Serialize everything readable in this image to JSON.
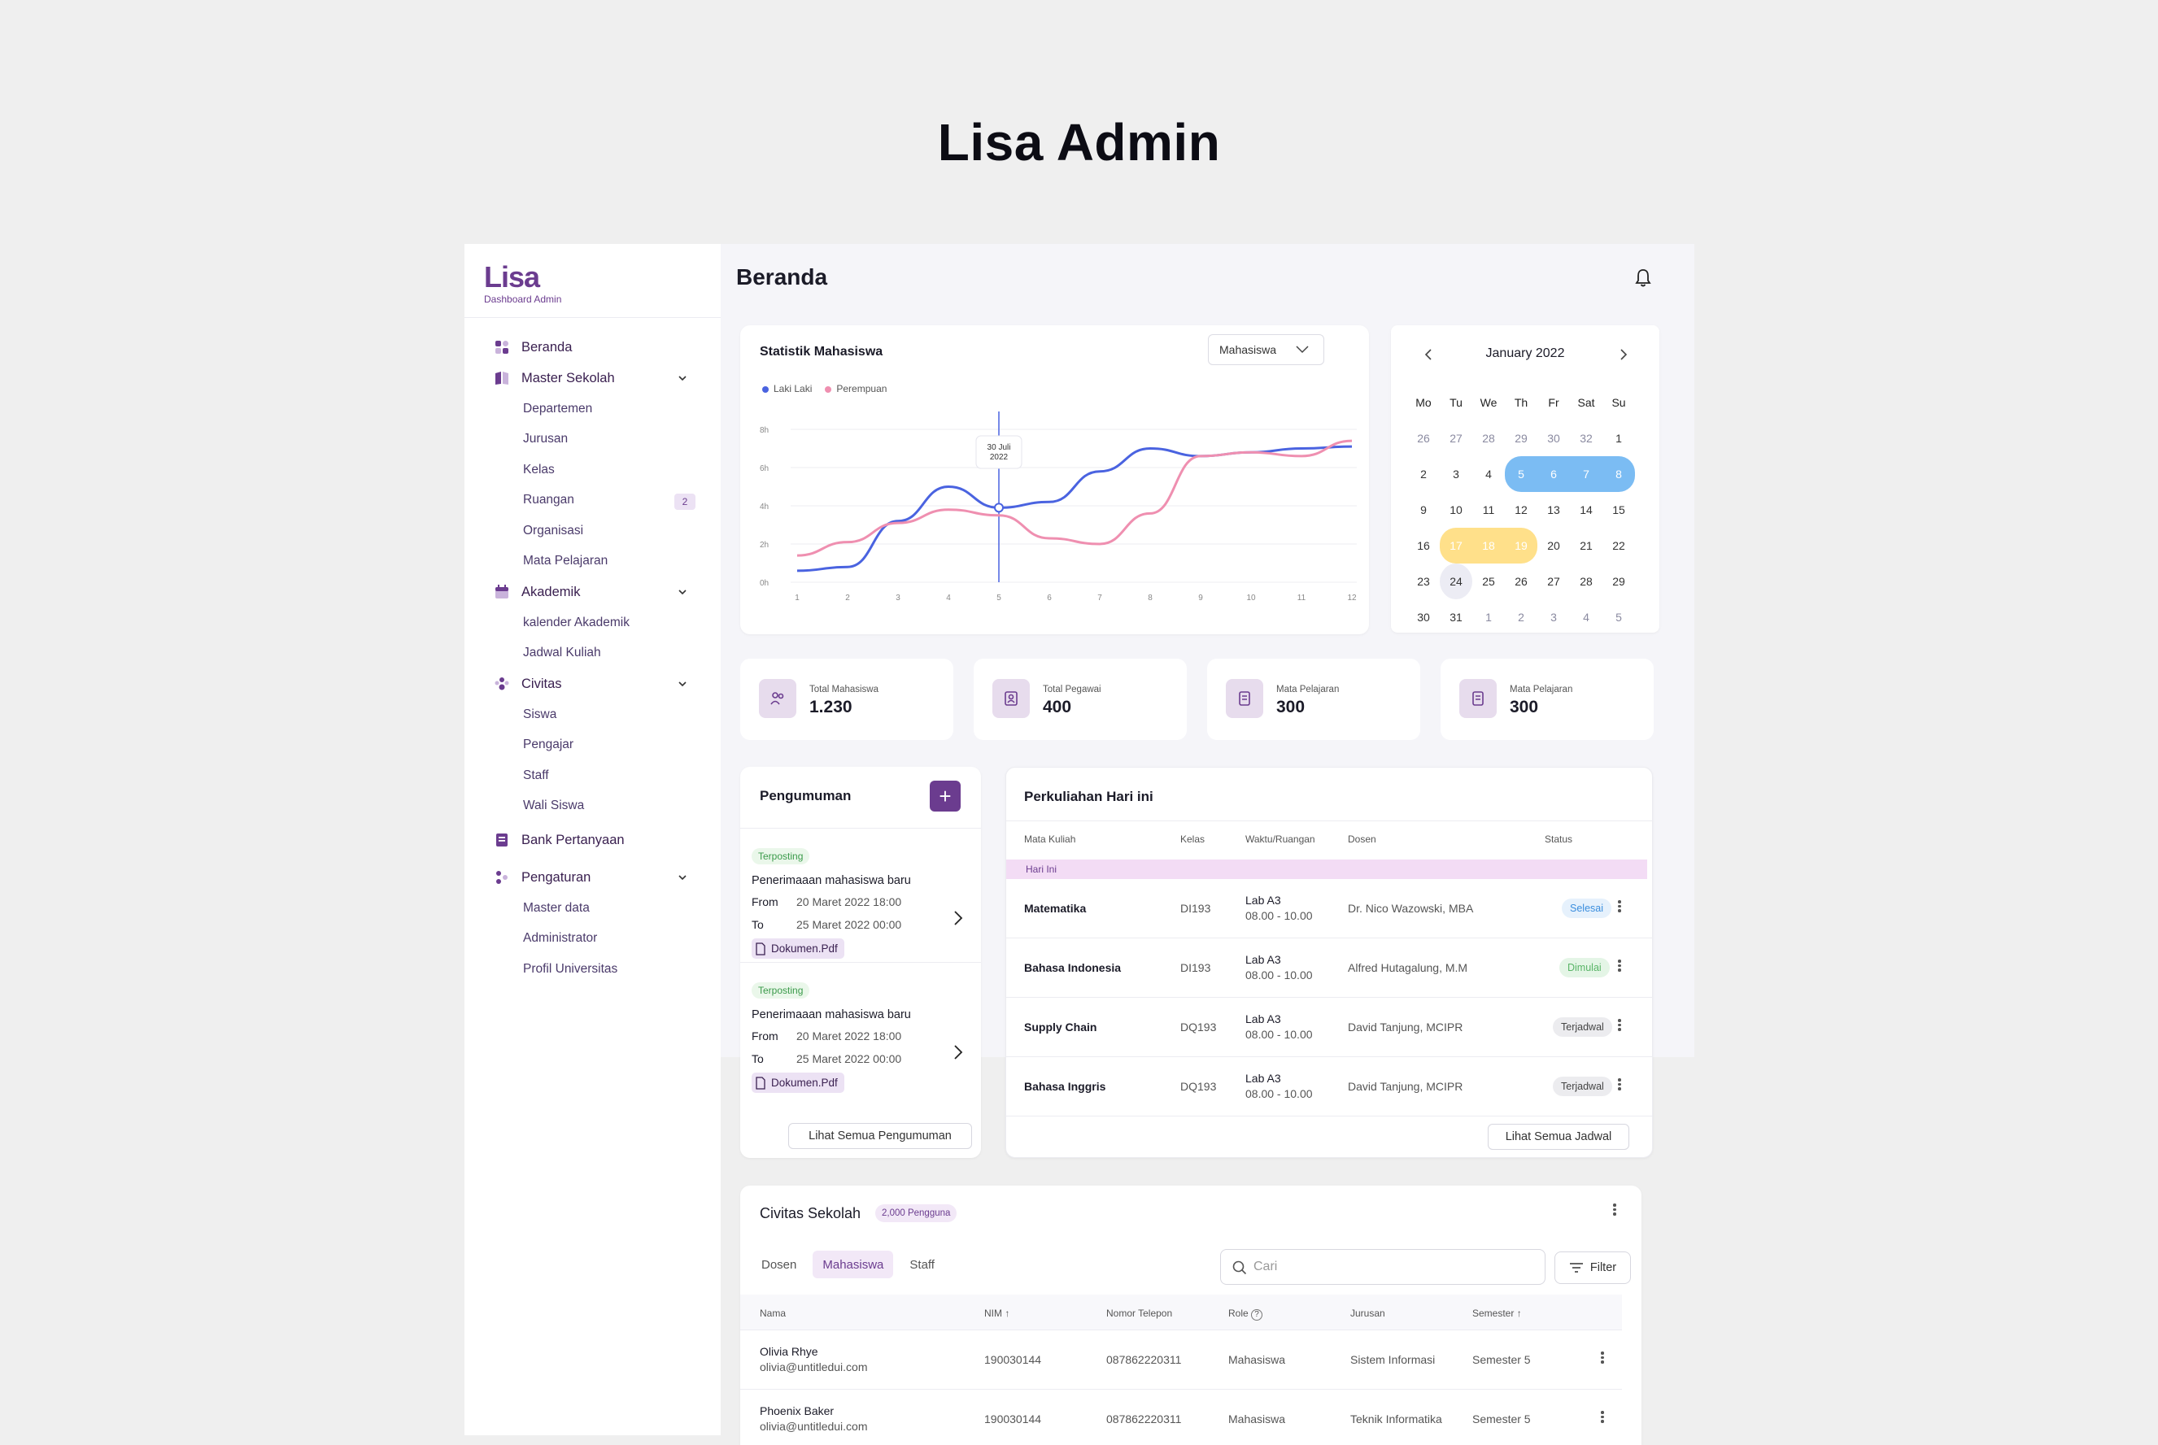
{
  "hero_title": "Lisa Admin",
  "brand": {
    "logo": "Lisa",
    "subtitle": "Dashboard Admin",
    "accent": "#6b3c8f"
  },
  "sidebar": {
    "items": [
      {
        "label": "Beranda",
        "icon": "grid-icon"
      },
      {
        "label": "Master Sekolah",
        "icon": "book-icon",
        "children": [
          "Departemen",
          "Jurusan",
          "Kelas",
          "Ruangan",
          "Organisasi",
          "Mata Pelajaran"
        ],
        "badge": "2"
      },
      {
        "label": "Akademik",
        "icon": "calendar-icon",
        "children": [
          "kalender Akademik",
          "Jadwal Kuliah"
        ]
      },
      {
        "label": "Civitas",
        "icon": "people-icon",
        "children": [
          "Siswa",
          "Pengajar",
          "Staff",
          "Wali Siswa"
        ]
      },
      {
        "label": "Bank Pertanyaan",
        "icon": "notebook-icon"
      },
      {
        "label": "Pengaturan",
        "icon": "settings-icon",
        "children": [
          "Master data",
          "Administrator",
          "Profil Universitas"
        ]
      }
    ]
  },
  "page_title": "Beranda",
  "stats_chart": {
    "title": "Statistik Mahasiswa",
    "select": "Mahasiswa",
    "tooltip_day": "30 Juli",
    "tooltip_year": "2022"
  },
  "chart_data": {
    "type": "line",
    "x": [
      1,
      2,
      3,
      4,
      5,
      6,
      7,
      8,
      9,
      10,
      11,
      12
    ],
    "y_ticks": [
      "0h",
      "2h",
      "4h",
      "6h",
      "8h"
    ],
    "ylim": [
      0,
      8
    ],
    "series": [
      {
        "name": "Laki Laki",
        "color": "#4a63e0",
        "values": [
          0.6,
          0.8,
          3.2,
          5.0,
          3.9,
          4.2,
          5.8,
          7.0,
          6.6,
          6.8,
          7.0,
          7.1
        ]
      },
      {
        "name": "Perempuan",
        "color": "#ef8fb0",
        "values": [
          1.4,
          2.1,
          3.1,
          3.8,
          3.5,
          2.3,
          2.0,
          3.6,
          6.6,
          6.8,
          6.6,
          7.4
        ]
      }
    ],
    "marker_x": 5
  },
  "calendar": {
    "month": "January 2022",
    "weekdays": [
      "Mo",
      "Tu",
      "We",
      "Th",
      "Fr",
      "Sat",
      "Su"
    ],
    "days": [
      [
        "26",
        "27",
        "28",
        "29",
        "30",
        "32",
        "1"
      ],
      [
        "2",
        "3",
        "4",
        "5",
        "6",
        "7",
        "8"
      ],
      [
        "9",
        "10",
        "11",
        "12",
        "13",
        "14",
        "15"
      ],
      [
        "16",
        "17",
        "18",
        "19",
        "20",
        "21",
        "22"
      ],
      [
        "23",
        "24",
        "25",
        "26",
        "27",
        "28",
        "29"
      ],
      [
        "30",
        "31",
        "1",
        "2",
        "3",
        "4",
        "5"
      ]
    ],
    "range_blue": [
      "5",
      "6",
      "7",
      "8"
    ],
    "range_yellow": [
      "17",
      "18",
      "19"
    ],
    "today": "24",
    "blue": "#7bbcf3",
    "yellow": "#ffe08a"
  },
  "stats": [
    {
      "label": "Total Mahasiswa",
      "value": "1.230",
      "icon": "people-icon"
    },
    {
      "label": "Total Pegawai",
      "value": "400",
      "icon": "id-card-icon"
    },
    {
      "label": "Mata Pelajaran",
      "value": "300",
      "icon": "book-icon"
    },
    {
      "label": "Mata Pelajaran",
      "value": "300",
      "icon": "book-icon"
    }
  ],
  "announcements": {
    "title": "Pengumuman",
    "add": "+",
    "items": [
      {
        "tag": "Terposting",
        "title": "Penerimaaan mahasiswa baru",
        "from_label": "From",
        "from": "20 Maret 2022 18:00",
        "to_label": "To",
        "to": "25 Maret 2022 00:00",
        "doc": "Dokumen.Pdf"
      },
      {
        "tag": "Terposting",
        "title": "Penerimaaan mahasiswa baru",
        "from_label": "From",
        "from": "20 Maret 2022 18:00",
        "to_label": "To",
        "to": "25 Maret 2022 00:00",
        "doc": "Dokumen.Pdf"
      }
    ],
    "view_all": "Lihat Semua Pengumuman"
  },
  "lectures": {
    "title": "Perkuliahan Hari ini",
    "headers": [
      "Mata Kuliah",
      "Kelas",
      "Waktu/Ruangan",
      "Dosen",
      "Status"
    ],
    "group": "Hari Ini",
    "rows": [
      {
        "course": "Matematika",
        "class": "DI193",
        "room": "Lab A3",
        "time": "08.00 - 10.00",
        "lecturer": "Dr. Nico Wazowski, MBA",
        "status": "Selesai"
      },
      {
        "course": "Bahasa Indonesia",
        "class": "DI193",
        "room": "Lab A3",
        "time": "08.00 - 10.00",
        "lecturer": "Alfred Hutagalung, M.M",
        "status": "Dimulai"
      },
      {
        "course": "Supply Chain",
        "class": "DQ193",
        "room": "Lab A3",
        "time": "08.00 - 10.00",
        "lecturer": "David Tanjung, MCIPR",
        "status": "Terjadwal"
      },
      {
        "course": "Bahasa Inggris",
        "class": "DQ193",
        "room": "Lab A3",
        "time": "08.00 - 10.00",
        "lecturer": "David Tanjung, MCIPR",
        "status": "Terjadwal"
      }
    ],
    "view_all": "Lihat Semua Jadwal"
  },
  "civitas": {
    "title": "Civitas Sekolah",
    "badge": "2,000 Pengguna",
    "tabs": [
      "Dosen",
      "Mahasiswa",
      "Staff"
    ],
    "search_placeholder": "Cari",
    "filter": "Filter",
    "headers": [
      "Nama",
      "NIM",
      "Nomor Telepon",
      "Role",
      "Jurusan",
      "Semester"
    ],
    "rows": [
      {
        "name": "Olivia Rhye",
        "email": "olivia@untitledui.com",
        "nim": "190030144",
        "phone": "087862220311",
        "role": "Mahasiswa",
        "major": "Sistem Informasi",
        "semester": "Semester 5"
      },
      {
        "name": "Phoenix Baker",
        "email": "olivia@untitledui.com",
        "nim": "190030144",
        "phone": "087862220311",
        "role": "Mahasiswa",
        "major": "Teknik Informatika",
        "semester": "Semester 5"
      }
    ]
  }
}
